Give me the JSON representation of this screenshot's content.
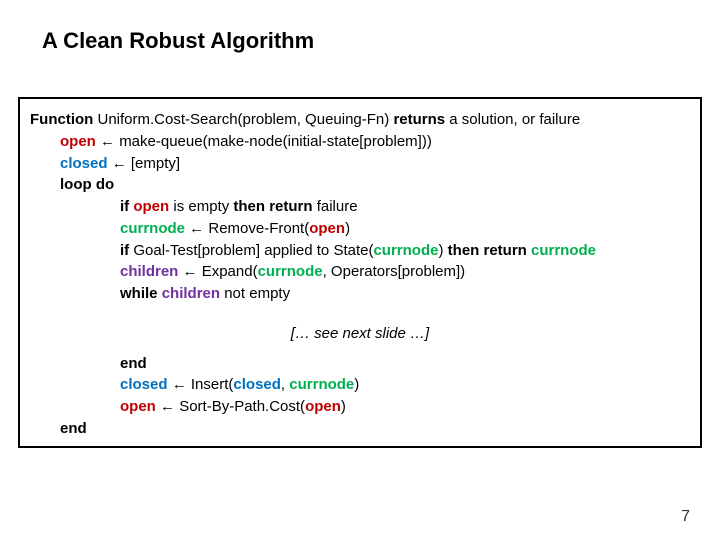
{
  "title": "A Clean Robust Algorithm",
  "kw": {
    "function": "Function",
    "returns": "returns",
    "loop_do": "loop do",
    "if": "if",
    "then_return": "then return",
    "while": "while",
    "end": "end"
  },
  "sym": {
    "open": "open",
    "closed": "closed",
    "currnode": "currnode",
    "children": "children"
  },
  "txt": {
    "fn_sig": " Uniform.Cost-Search(problem, Queuing-Fn) ",
    "ret_tail": " a solution, or failure",
    "arrow": " ← ",
    "open_init": "make-queue(make-node(initial-state[problem]))",
    "closed_init": "[empty]",
    "is_empty": " is empty ",
    "failure": " failure",
    "remove_front_pre": "Remove-Front(",
    "paren_close": ")",
    "goal_test_pre": " Goal-Test[problem] applied to State(",
    "goal_test_post": ") ",
    "expand_pre": "Expand(",
    "expand_mid": ", Operators[problem])",
    "not_empty": " not empty",
    "insert_pre": "Insert(",
    "comma_sp": ", ",
    "sort_pre": "Sort-By-Path.Cost("
  },
  "see_next": "[… see next slide …]",
  "page_number": "7"
}
